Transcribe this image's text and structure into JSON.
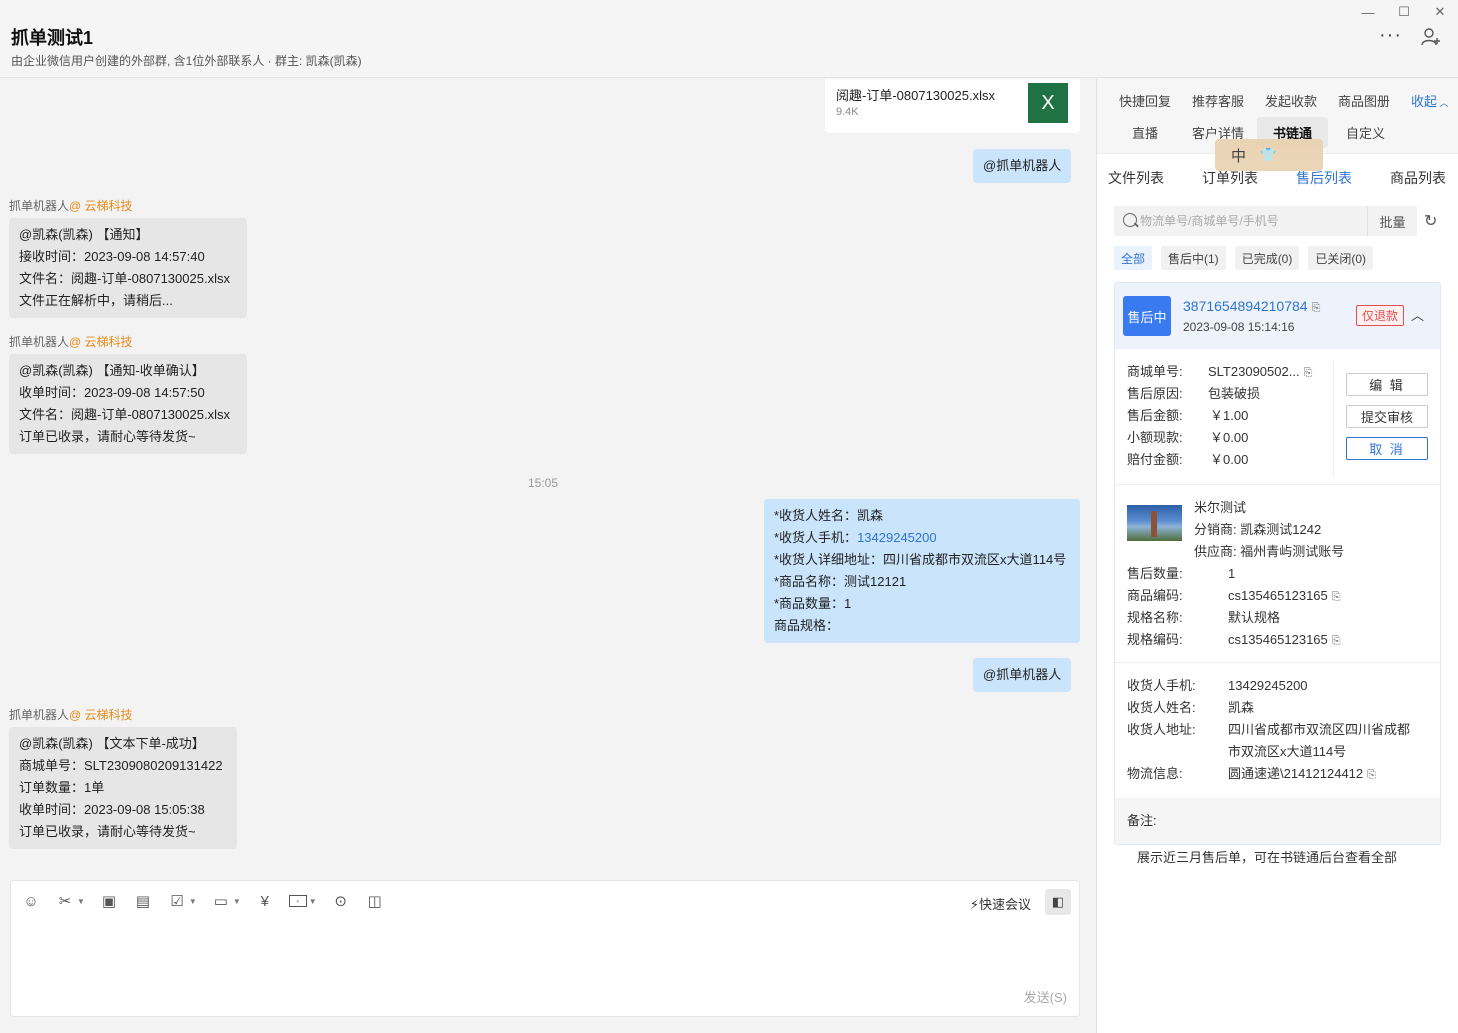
{
  "window": {
    "minimize": "—",
    "maximize": "☐",
    "close": "✕"
  },
  "header": {
    "title": "抓单测试1",
    "subtitle": "由企业微信用户创建的外部群, 含1位外部联系人 · 群主: 凯森(凯森)",
    "more": "···"
  },
  "chat": {
    "file": {
      "name": "阅趣-订单-0807130025.xlsx",
      "size": "9.4K",
      "icon": "X"
    },
    "mention1": "@抓单机器人",
    "msg1": {
      "sender": "抓单机器人",
      "org": "@ 云梯科技",
      "lines": [
        "@凯森(凯森) 【通知】",
        "接收时间：2023-09-08 14:57:40",
        "文件名：阅趣-订单-0807130025.xlsx",
        "文件正在解析中，请稍后..."
      ]
    },
    "msg2": {
      "sender": "抓单机器人",
      "org": "@ 云梯科技",
      "lines": [
        "@凯森(凯森) 【通知-收单确认】",
        "收单时间：2023-09-08 14:57:50",
        "文件名：阅趣-订单-0807130025.xlsx",
        "订单已收录，请耐心等待发货~"
      ]
    },
    "time": "15:05",
    "order_msg": {
      "l1": "*收货人姓名：凯森",
      "l2_prefix": "*收货人手机：",
      "l2_phone": "13429245200",
      "l3": "*收货人详细地址：四川省成都市双流区x大道114号",
      "l4": "*商品名称：测试12121",
      "l5": "*商品数量：1",
      "l6": "商品规格："
    },
    "mention2": "@抓单机器人",
    "msg3": {
      "sender": "抓单机器人",
      "org": "@ 云梯科技",
      "lines": [
        "@凯森(凯森) 【文本下单-成功】",
        "商城单号：SLT2309080209131422",
        "订单数量：1单",
        "收单时间：2023-09-08 15:05:38",
        "订单已收录，请耐心等待发货~"
      ]
    }
  },
  "composer": {
    "quick_meeting": "快速会议",
    "send": "发送(S)"
  },
  "panel": {
    "tabs_row1": [
      "快捷回复",
      "推荐客服",
      "发起收款",
      "商品图册",
      "收起"
    ],
    "tabs_row2": [
      "直播",
      "客户详情",
      "书链通",
      "自定义"
    ],
    "sub_tabs": [
      "文件列表",
      "订单列表",
      "售后列表",
      "商品列表"
    ],
    "floater": {
      "char": "中"
    },
    "search": {
      "placeholder": "物流单号/商城单号/手机号",
      "batch": "批量"
    },
    "filters": [
      "全部",
      "售后中(1)",
      "已完成(0)",
      "已关闭(0)"
    ],
    "card": {
      "status": "售后中",
      "order_no": "3871654894210784",
      "time": "2023-09-08 15:14:16",
      "tag": "仅退款",
      "mall_no_label": "商城单号:",
      "mall_no": "SLT23090502...",
      "reason_label": "售后原因:",
      "reason": "包装破损",
      "amount_label": "售后金额:",
      "amount": "￥1.00",
      "small_cash_label": "小额现款:",
      "small_cash": "￥0.00",
      "compensation_label": "赔付金额:",
      "compensation": "￥0.00",
      "btn_edit": "编 辑",
      "btn_submit": "提交审核",
      "btn_cancel": "取 消",
      "product_name": "米尔测试",
      "distributor_label": "分销商:",
      "distributor": "凯森测试1242",
      "supplier_label": "供应商:",
      "supplier": "福州青屿测试账号",
      "qty_label": "售后数量:",
      "qty": "1",
      "sku_code_label": "商品编码:",
      "sku_code": "cs135465123165",
      "spec_name_label": "规格名称:",
      "spec_name": "默认规格",
      "spec_code_label": "规格编码:",
      "spec_code": "cs135465123165",
      "phone_label": "收货人手机:",
      "phone": "13429245200",
      "name_label": "收货人姓名:",
      "name": "凯森",
      "addr_label": "收货人地址:",
      "addr1": "四川省成都市双流区四川省成都",
      "addr2": "市双流区x大道114号",
      "logistics_label": "物流信息:",
      "logistics": "圆通速递\\21412124412",
      "remark_label": "备注:"
    },
    "footer_note": "展示近三月售后单，可在书链通后台查看全部"
  },
  "colors": {
    "accent": "#2f74d0",
    "bubble_self": "#c9e4fb",
    "bubble_other": "#e6e6e6",
    "org": "#e88a1a",
    "excel": "#1f7244",
    "status_blue": "#3a7af0",
    "refund_red": "#e05050"
  }
}
